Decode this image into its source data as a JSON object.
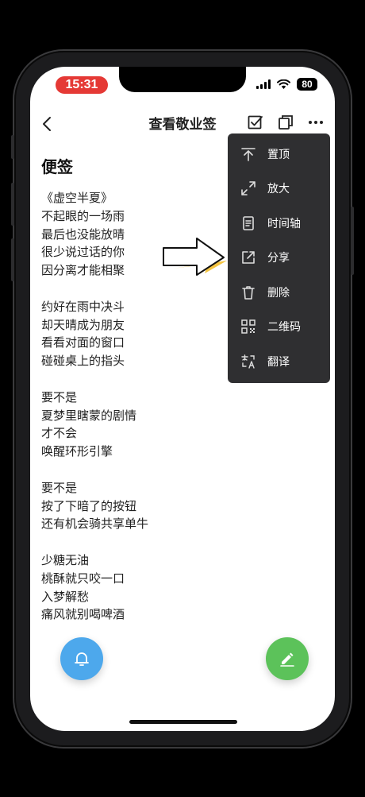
{
  "status_bar": {
    "time": "15:31",
    "battery": "80"
  },
  "nav": {
    "title": "查看敬业签"
  },
  "note": {
    "heading": "便签",
    "stanzas": [
      [
        "《虚空半夏》",
        "不起眼的一场雨",
        "最后也没能放晴",
        "很少说过话的你",
        "因分离才能相聚"
      ],
      [
        "约好在雨中决斗",
        "却天晴成为朋友",
        "看看对面的窗口",
        "碰碰桌上的指头"
      ],
      [
        "要不是",
        "夏梦里瞎蒙的剧情",
        "才不会",
        "唤醒环形引擎"
      ],
      [
        "要不是",
        "按了下暗了的按钮",
        "还有机会骑共享单牛"
      ],
      [
        "少糖无油",
        "桃酥就只咬一口",
        "入梦解愁",
        "痛风就别喝啤酒"
      ]
    ]
  },
  "menu": {
    "items": [
      {
        "label": "置顶",
        "icon": "pin-top-icon"
      },
      {
        "label": "放大",
        "icon": "expand-icon"
      },
      {
        "label": "时间轴",
        "icon": "timeline-icon"
      },
      {
        "label": "分享",
        "icon": "share-icon"
      },
      {
        "label": "删除",
        "icon": "trash-icon"
      },
      {
        "label": "二维码",
        "icon": "qrcode-icon"
      },
      {
        "label": "翻译",
        "icon": "translate-icon"
      }
    ]
  },
  "colors": {
    "status_time_bg": "#e53935",
    "menu_bg": "#2f2f31",
    "fab_bell": "#4da8ec",
    "fab_edit": "#5cc25a",
    "annotation_highlight": "#f5c542"
  }
}
